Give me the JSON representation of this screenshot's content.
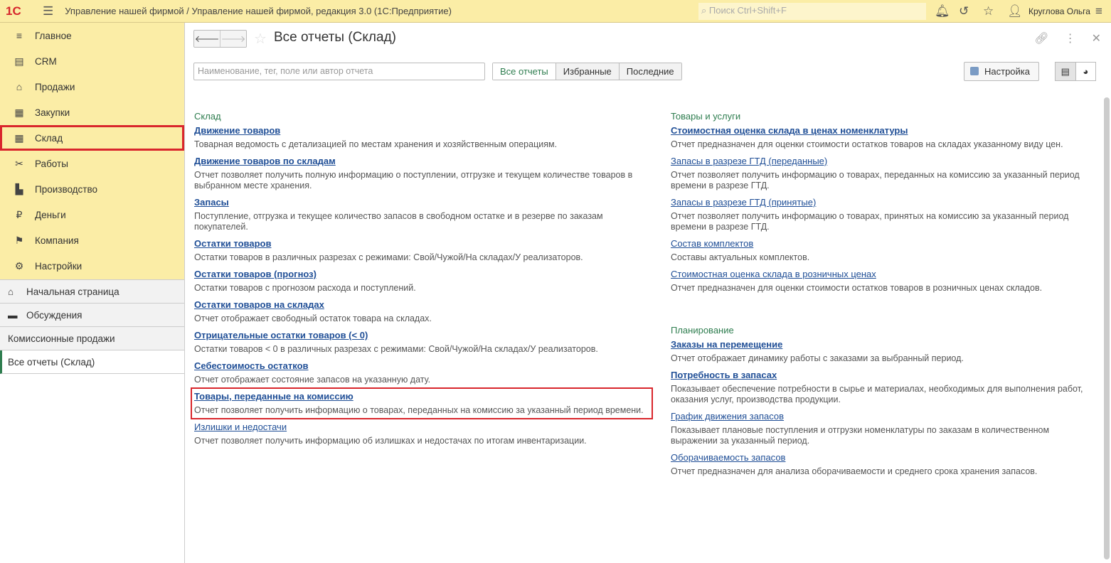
{
  "topbar": {
    "logo": "1С",
    "title": "Управление нашей фирмой / Управление нашей фирмой, редакция 3.0  (1С:Предприятие)",
    "search_placeholder": "Поиск Ctrl+Shift+F",
    "user": "Круглова Ольга"
  },
  "sidebar": {
    "sections": [
      {
        "label": "Главное",
        "icon": "≡"
      },
      {
        "label": "CRM",
        "icon": "▤"
      },
      {
        "label": "Продажи",
        "icon": "⌂"
      },
      {
        "label": "Закупки",
        "icon": "▦"
      },
      {
        "label": "Склад",
        "icon": "▦"
      },
      {
        "label": "Работы",
        "icon": "✂"
      },
      {
        "label": "Производство",
        "icon": "▙"
      },
      {
        "label": "Деньги",
        "icon": "₽"
      },
      {
        "label": "Компания",
        "icon": "⚑"
      },
      {
        "label": "Настройки",
        "icon": "⚙"
      }
    ],
    "home": "Начальная страница",
    "discussions": "Обсуждения",
    "open1": "Комиссионные продажи",
    "open2": "Все отчеты (Склад)"
  },
  "main": {
    "title": "Все отчеты (Склад)",
    "search_placeholder": "Наименование, тег, поле или автор отчета",
    "tabs": [
      "Все отчеты",
      "Избранные",
      "Последние"
    ],
    "settings": "Настройка",
    "left": {
      "group": "Склад",
      "reports": [
        {
          "name": "Движение товаров",
          "desc": "Товарная ведомость с детализацией по местам хранения и хозяйственным операциям.",
          "bold": true
        },
        {
          "name": "Движение товаров по складам",
          "desc": "Отчет позволяет получить полную информацию о поступлении, отгрузке и текущем количестве товаров в выбранном месте хранения.",
          "bold": true
        },
        {
          "name": "Запасы",
          "desc": "Поступление, отгрузка и текущее количество запасов в свободном остатке и в резерве по заказам покупателей.",
          "bold": true
        },
        {
          "name": "Остатки товаров",
          "desc": "Остатки товаров в различных разрезах с режимами: Свой/Чужой/На складах/У реализаторов.",
          "bold": true
        },
        {
          "name": "Остатки товаров (прогноз)",
          "desc": "Остатки товаров с прогнозом расхода и поступлений.",
          "bold": true
        },
        {
          "name": "Остатки товаров на складах",
          "desc": "Отчет отображает свободный остаток товара на складах.",
          "bold": true
        },
        {
          "name": "Отрицательные остатки товаров (< 0)",
          "desc": "Остатки товаров < 0 в различных разрезах с режимами: Свой/Чужой/На складах/У реализаторов.",
          "bold": true
        },
        {
          "name": "Себестоимость остатков",
          "desc": "Отчет отображает состояние запасов на указанную дату.",
          "bold": true
        },
        {
          "name": "Товары, переданные на комиссию",
          "desc": "Отчет позволяет получить информацию о товарах, переданных на комиссию за указанный период времени.",
          "bold": true
        },
        {
          "name": "Излишки и недостачи",
          "desc": "Отчет позволяет получить информацию об излишках и недостачах по итогам инвентаризации.",
          "bold": false
        }
      ]
    },
    "right": [
      {
        "group": "Товары и услуги",
        "reports": [
          {
            "name": "Стоимостная оценка склада в ценах номенклатуры",
            "desc": "Отчет предназначен для оценки стоимости остатков товаров на складах указанному виду цен.",
            "bold": true
          },
          {
            "name": "Запасы в разрезе ГТД (переданные)",
            "desc": "Отчет позволяет получить информацию о товарах, переданных на комиссию за указанный период времени в разрезе ГТД.",
            "bold": false
          },
          {
            "name": "Запасы в разрезе ГТД (принятые)",
            "desc": "Отчет позволяет получить информацию о товарах, принятых на комиссию за указанный период времени в разрезе ГТД.",
            "bold": false
          },
          {
            "name": "Состав комплектов",
            "desc": "Составы актуальных комплектов.",
            "bold": false
          },
          {
            "name": "Стоимостная оценка склада в розничных ценах",
            "desc": "Отчет предназначен для оценки стоимости остатков товаров в розничных ценах складов.",
            "bold": false
          }
        ]
      },
      {
        "group": "Планирование",
        "reports": [
          {
            "name": "Заказы на перемещение",
            "desc": "Отчет отображает динамику работы с заказами за выбранный период.",
            "bold": true
          },
          {
            "name": "Потребность в запасах",
            "desc": "Показывает обеспечение потребности в сырье и материалах, необходимых для выполнения работ, оказания услуг, производства продукции.",
            "bold": true
          },
          {
            "name": "График движения запасов",
            "desc": "Показывает плановые поступления и отгрузки номенклатуры по заказам в количественном выражении за указанный период.",
            "bold": false
          },
          {
            "name": "Оборачиваемость запасов",
            "desc": "Отчет предназначен для анализа оборачиваемости и среднего срока хранения запасов.",
            "bold": false
          }
        ]
      }
    ]
  }
}
